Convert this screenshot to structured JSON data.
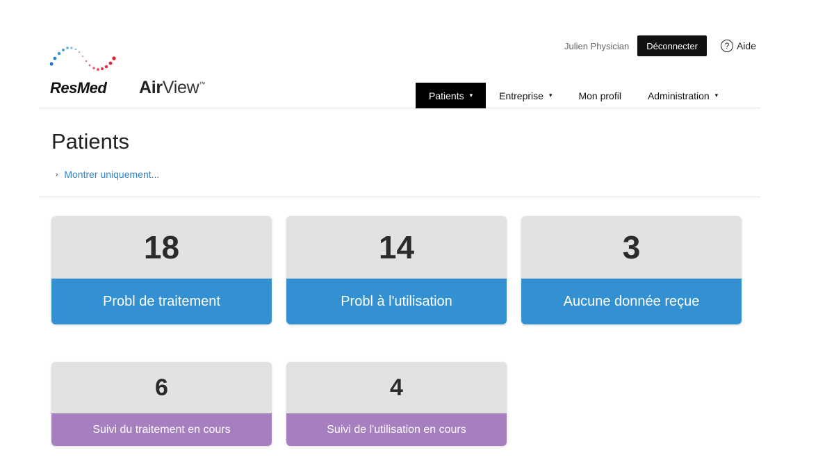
{
  "brand": {
    "company": "ResMed",
    "product_bold": "Air",
    "product_light": "View",
    "trademark": "™"
  },
  "user": {
    "name": "Julien Physician",
    "logout_label": "Déconnecter",
    "help_label": "Aide",
    "help_icon": "?"
  },
  "nav": {
    "items": [
      {
        "label": "Patients",
        "caret": "▾"
      },
      {
        "label": "Entreprise",
        "caret": "▾"
      },
      {
        "label": "Mon profil"
      },
      {
        "label": "Administration",
        "caret": "▾"
      }
    ]
  },
  "page": {
    "title": "Patients",
    "filter_label": "Montrer uniquement...",
    "filter_chevron": "›"
  },
  "tiles": [
    {
      "count": "18",
      "label": "Probl de traitement"
    },
    {
      "count": "14",
      "label": "Probl à l'utilisation"
    },
    {
      "count": "3",
      "label": "Aucune donnée reçue"
    },
    {
      "count": "6",
      "label": "Suivi du traitement en cours"
    },
    {
      "count": "4",
      "label": "Suivi de l'utilisation en cours"
    }
  ],
  "colors": {
    "primary_blue": "#3491d1",
    "follow_up_purple": "#a67fbf",
    "tile_gray": "#e2e2e2",
    "nav_active": "#000000",
    "link_blue": "#2e86c8"
  }
}
